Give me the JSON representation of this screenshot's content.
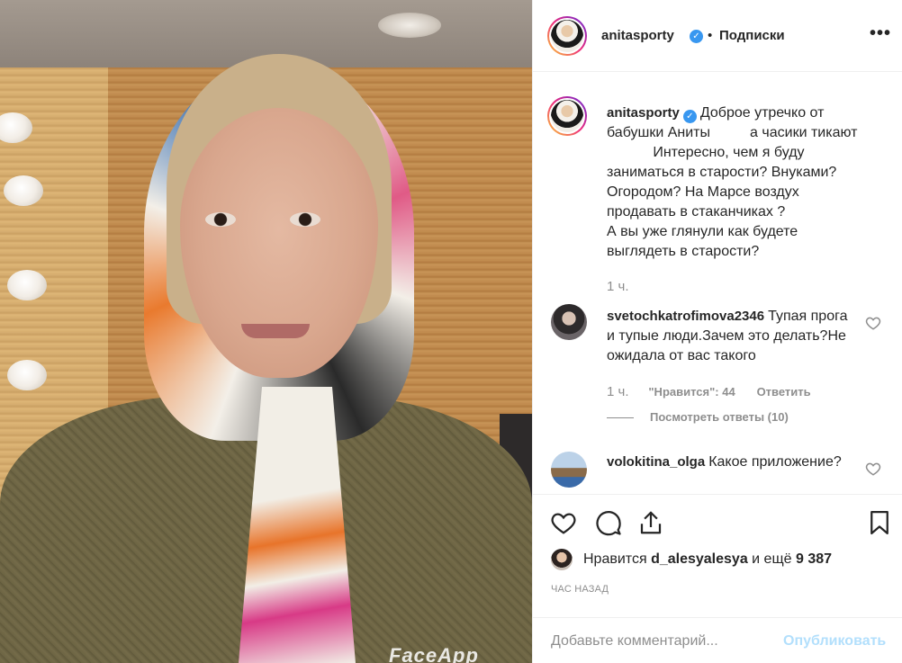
{
  "post": {
    "author": "anitasporty",
    "follow_status": "Подписки",
    "more_label": "•••",
    "dot": "•",
    "caption_lines": [
      "Доброе утречко от",
      "бабушки Аниты ⠀⠀⠀ а часики тикают",
      "⠀⠀⠀⠀ Интересно, чем я буду",
      "заниматься в старости? Внуками?",
      "Огородом? На Марсе воздух",
      "продавать в стаканчиках ?⠀",
      "А вы уже глянули как будете",
      "выглядеть в старости?"
    ],
    "caption_time": "1 ч.",
    "watermark": "FaceApp"
  },
  "comments": [
    {
      "user": "svetochkatrofimova2346",
      "text": "Тупая прога и тупые люди.Зачем это делать?Не ожидала от вас такого",
      "time": "1 ч.",
      "likes": "\"Нравится\": 44",
      "reply": "Ответить",
      "view_replies": "Посмотреть ответы (10)"
    },
    {
      "user": "volokitina_olga",
      "text": "Какое приложение?"
    }
  ],
  "actions": {
    "liked_by_prefix": "Нравится",
    "liked_by_user": "d_alesyalesya",
    "liked_by_suffix": "и ещё",
    "liked_count": "9 387",
    "time_ago": "час назад"
  },
  "add_comment": {
    "placeholder": "Добавьте комментарий...",
    "publish": "Опубликовать"
  }
}
